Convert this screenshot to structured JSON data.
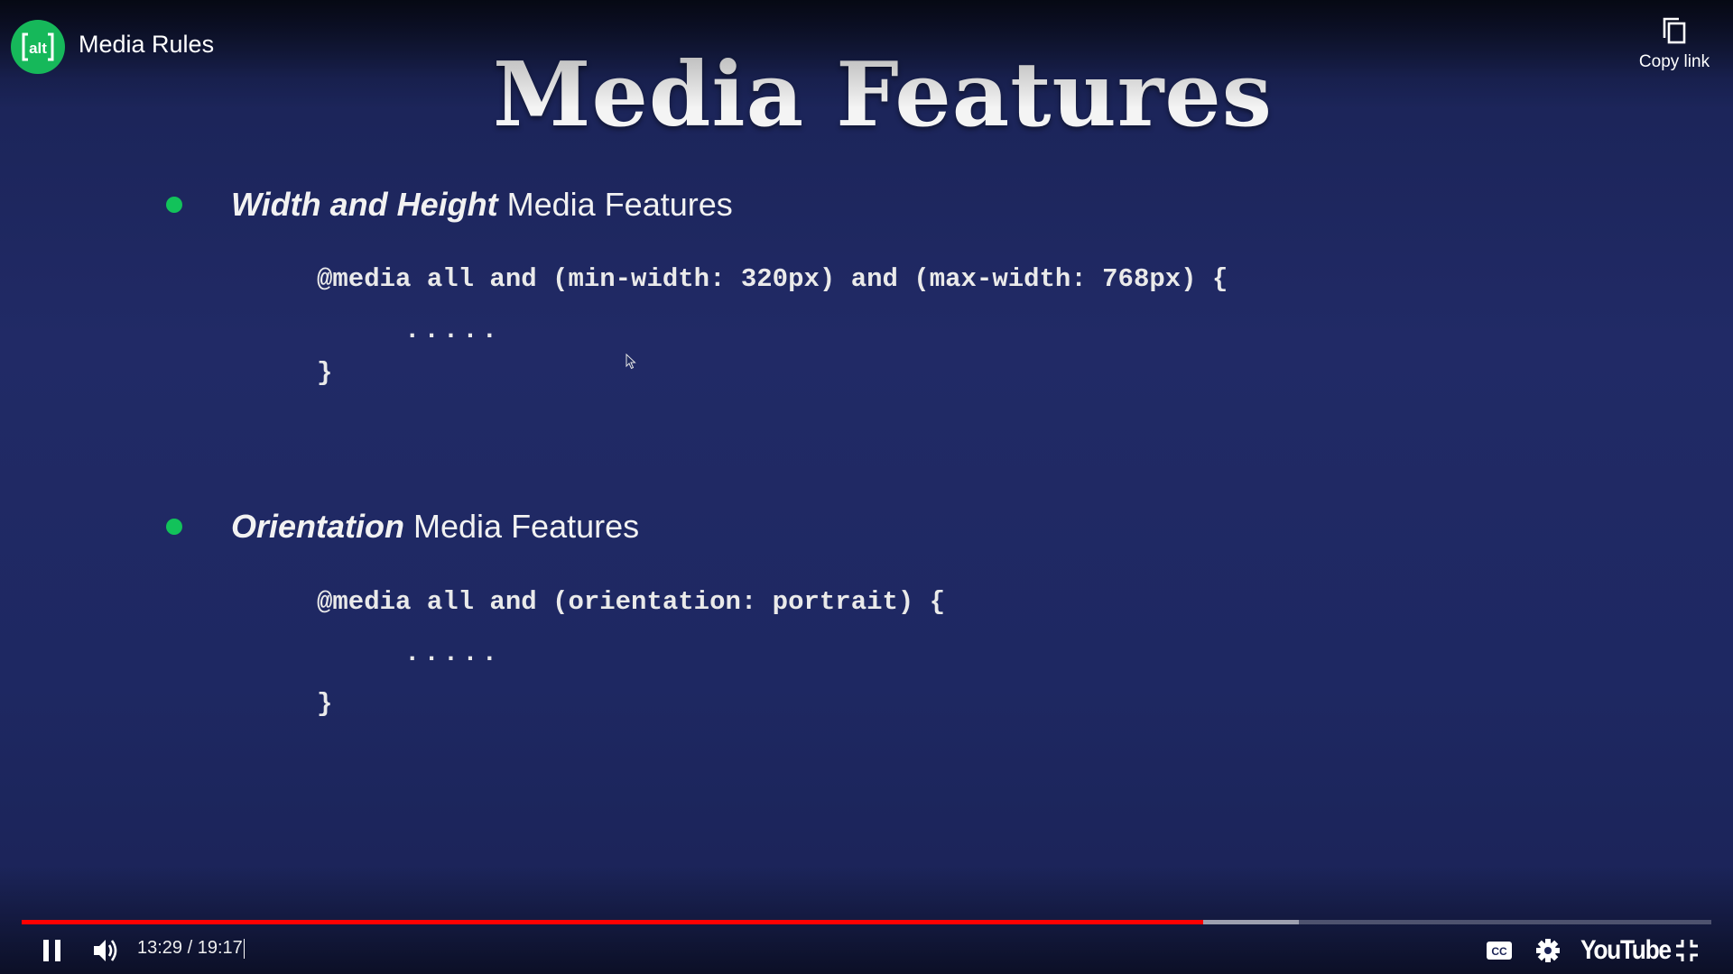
{
  "header": {
    "video_title": "Media Rules",
    "channel_logo_text": "alt",
    "copy_link_label": "Copy link"
  },
  "slide": {
    "title": "Media Features",
    "sections": [
      {
        "emphasis": "Width and Height",
        "rest": " Media Features",
        "code_line_1": "@media all and (min-width: 320px) and (max-width: 768px) {",
        "code_line_2": ".....",
        "code_line_3": "}"
      },
      {
        "emphasis": "Orientation",
        "rest": " Media Features",
        "code_line_1": "@media all and (orientation: portrait) {",
        "code_line_2": ".....",
        "code_line_3": "}"
      }
    ],
    "bullet_color": "#12c25a"
  },
  "controls": {
    "current_time": "13:29",
    "duration": "19:17",
    "time_text": "13:29 / 19:17",
    "played_fraction": 0.699,
    "buffered_fraction": 0.756,
    "progress_color": "#ff0000",
    "brand": "YouTube",
    "icons": [
      "pause-icon",
      "volume-icon",
      "closed-captions-icon",
      "settings-gear-icon",
      "exit-fullscreen-icon",
      "copy-icon"
    ]
  }
}
